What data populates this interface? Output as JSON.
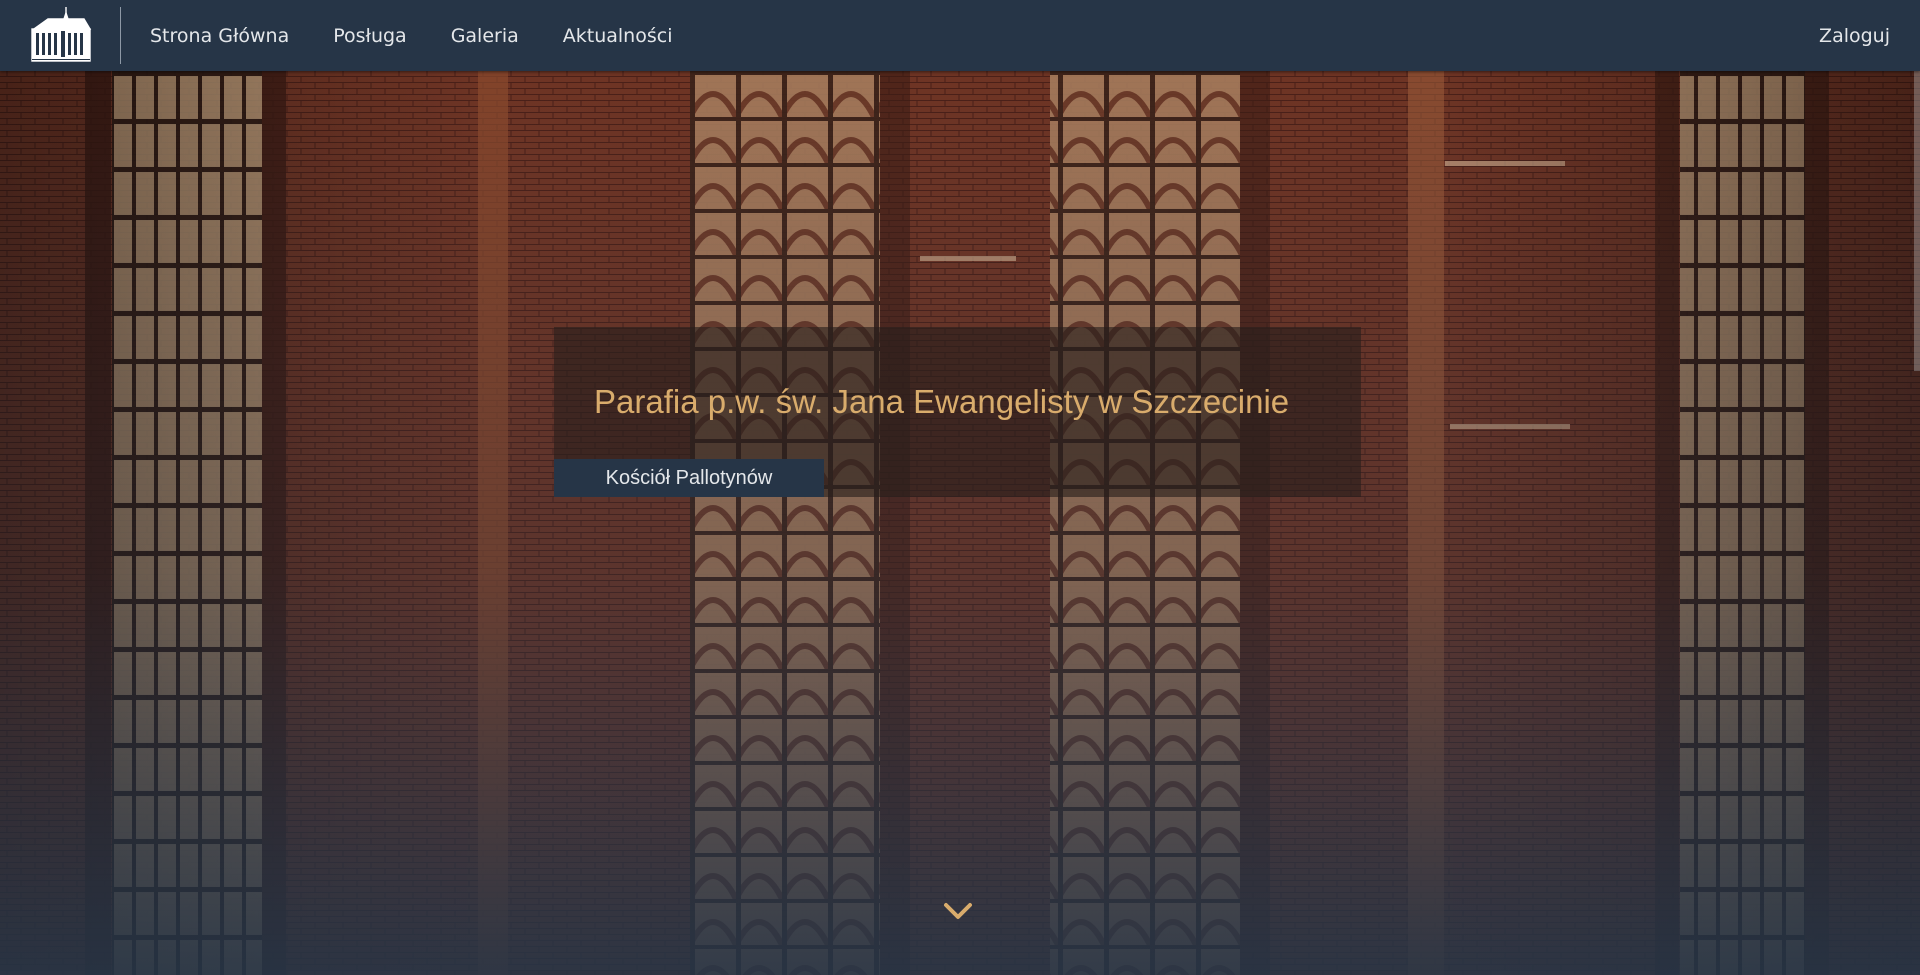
{
  "nav": {
    "logo_alt": "church-logo",
    "links": [
      "Strona Główna",
      "Posługa",
      "Galeria",
      "Aktualności"
    ],
    "login_label": "Zaloguj"
  },
  "hero": {
    "title": "Parafia p.w. św. Jana Ewangelisty w Szczecinie",
    "subtitle": "Kościół Pallotynów",
    "scroll_icon": "chevron-down-icon"
  },
  "colors": {
    "navbar": "#263547",
    "accent_gold": "#d9ac6c",
    "text_light": "#e4e7ea",
    "brick": "#6b3322"
  }
}
